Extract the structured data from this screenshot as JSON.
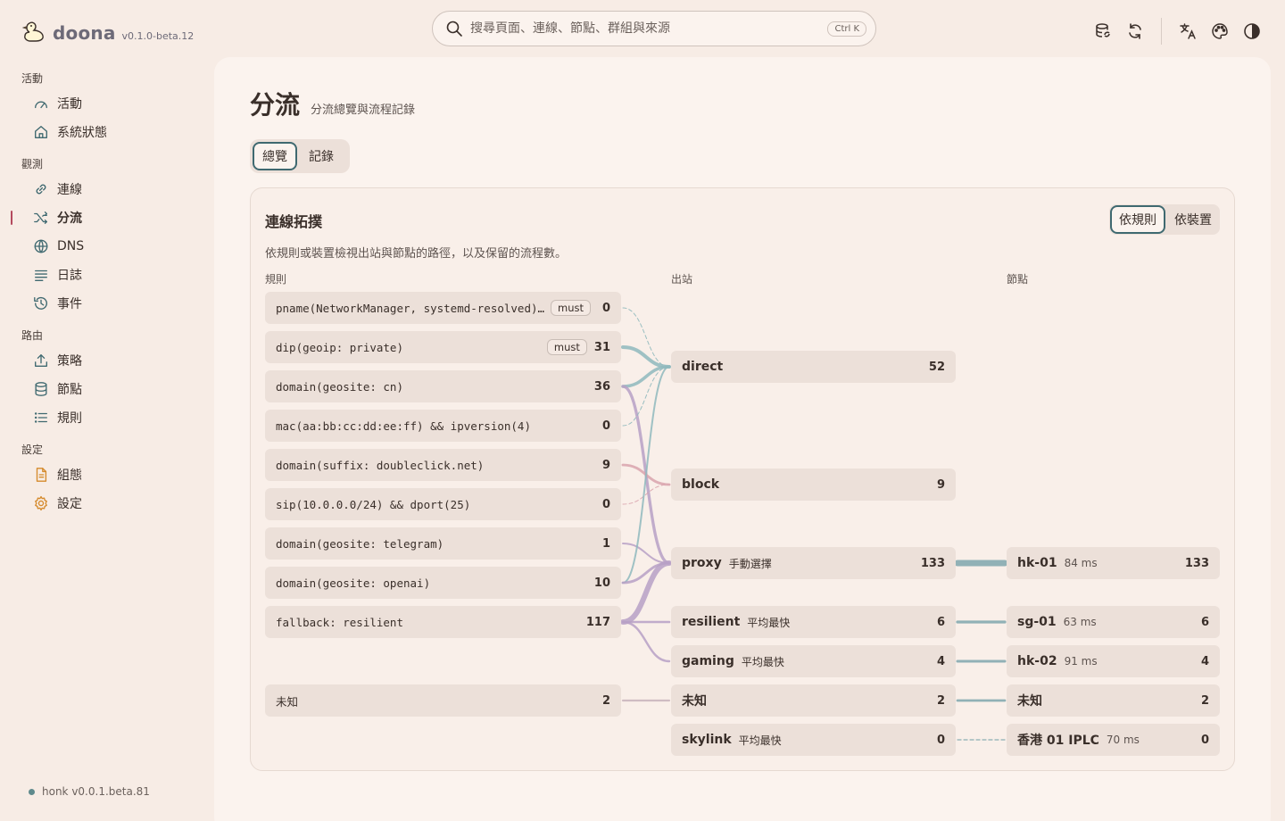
{
  "brand": {
    "name": "doona",
    "version": "v0.1.0-beta.12"
  },
  "search": {
    "placeholder": "搜尋頁面、連線、節點、群組與來源",
    "shortcut": "Ctrl K"
  },
  "nav": [
    {
      "title": "活動",
      "items": [
        {
          "label": "活動",
          "icon": "gauge-icon",
          "active": false
        },
        {
          "label": "系統狀態",
          "icon": "home-icon",
          "active": false
        }
      ]
    },
    {
      "title": "觀測",
      "items": [
        {
          "label": "連線",
          "icon": "link-icon",
          "active": false
        },
        {
          "label": "分流",
          "icon": "shuffle-icon",
          "active": true
        },
        {
          "label": "DNS",
          "icon": "globe-icon",
          "active": false
        },
        {
          "label": "日誌",
          "icon": "lines-icon",
          "active": false
        },
        {
          "label": "事件",
          "icon": "history-icon",
          "active": false
        }
      ]
    },
    {
      "title": "路由",
      "items": [
        {
          "label": "策略",
          "icon": "upload-icon",
          "active": false
        },
        {
          "label": "節點",
          "icon": "database-icon",
          "active": false
        },
        {
          "label": "規則",
          "icon": "list-icon",
          "active": false
        }
      ]
    },
    {
      "title": "設定",
      "items": [
        {
          "label": "組態",
          "icon": "file-icon",
          "active": false
        },
        {
          "label": "設定",
          "icon": "cog-icon",
          "active": false
        }
      ]
    }
  ],
  "footer": {
    "status": "honk v0.0.1.beta.81",
    "status_color": "#5f8a8c"
  },
  "page": {
    "title": "分流",
    "subtitle": "分流總覽與流程記錄"
  },
  "tabs": [
    {
      "label": "總覽",
      "active": true
    },
    {
      "label": "記錄",
      "active": false
    }
  ],
  "card": {
    "title": "連線拓撲",
    "description": "依規則或裝置檢視出站與節點的路徑，以及保留的流程數。",
    "modes": [
      {
        "label": "依規則",
        "active": true
      },
      {
        "label": "依裝置",
        "active": false
      }
    ],
    "columns": {
      "rules": "規則",
      "outbounds": "出站",
      "nodes": "節點"
    }
  },
  "rules": [
    {
      "text": "pname(NetworkManager, systemd-resolved) &…",
      "badge": "must",
      "count": 0
    },
    {
      "text": "dip(geoip: private)",
      "badge": "must",
      "count": 31
    },
    {
      "text": "domain(geosite: cn)",
      "badge": "",
      "count": 36
    },
    {
      "text": "mac(aa:bb:cc:dd:ee:ff) && ipversion(4)",
      "badge": "",
      "count": 0
    },
    {
      "text": "domain(suffix: doubleclick.net)",
      "badge": "",
      "count": 9
    },
    {
      "text": "sip(10.0.0.0/24) && dport(25)",
      "badge": "",
      "count": 0
    },
    {
      "text": "domain(geosite: telegram)",
      "badge": "",
      "count": 1
    },
    {
      "text": "domain(geosite: openai)",
      "badge": "",
      "count": 10
    },
    {
      "text": "fallback: resilient",
      "badge": "",
      "count": 117
    },
    {
      "text": "未知",
      "badge": "",
      "count": 2
    }
  ],
  "outbounds": [
    {
      "name": "direct",
      "sub": "",
      "count": 52
    },
    {
      "name": "block",
      "sub": "",
      "count": 9
    },
    {
      "name": "proxy",
      "sub": "手動選擇",
      "count": 133
    },
    {
      "name": "resilient",
      "sub": "平均最快",
      "count": 6
    },
    {
      "name": "gaming",
      "sub": "平均最快",
      "count": 4
    },
    {
      "name": "未知",
      "sub": "",
      "count": 2
    },
    {
      "name": "skylink",
      "sub": "平均最快",
      "count": 0
    }
  ],
  "nodes": [
    {
      "name": "hk-01",
      "latency": "84 ms",
      "count": 133
    },
    {
      "name": "sg-01",
      "latency": "63 ms",
      "count": 6
    },
    {
      "name": "hk-02",
      "latency": "91 ms",
      "count": 4
    },
    {
      "name": "未知",
      "latency": "",
      "count": 2
    },
    {
      "name": "香港 01 IPLC",
      "latency": "70 ms",
      "count": 0
    }
  ],
  "colors": {
    "direct": "#8fb8bd",
    "block": "#d9a3ad",
    "proxy": "#b7a0c6",
    "node": "#7fa6ad",
    "unknown": "#c8b3bb",
    "accent": "#3f6970"
  }
}
